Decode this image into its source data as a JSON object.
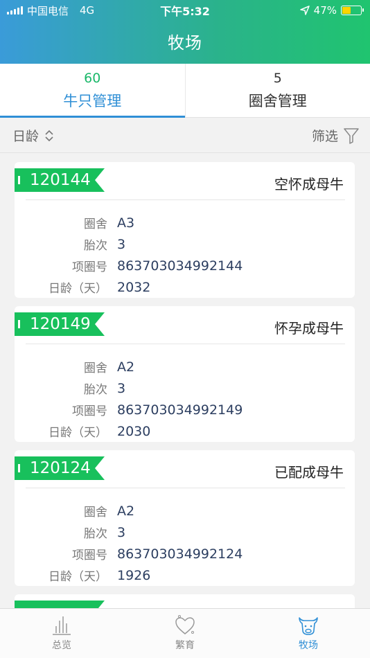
{
  "status_bar": {
    "carrier": "中国电信",
    "network": "4G",
    "time": "下午5:32",
    "battery": "47%",
    "battery_level": 0.47
  },
  "header": {
    "title": "牧场"
  },
  "tabs": [
    {
      "count": "60",
      "label": "牛只管理",
      "active": true
    },
    {
      "count": "5",
      "label": "圈舍管理",
      "active": false
    }
  ],
  "toolbar": {
    "sort_label": "日龄",
    "filter_label": "筛选"
  },
  "cards": [
    {
      "id": "120144",
      "status": "空怀成母牛",
      "pen_label": "圈舍",
      "pen": "A3",
      "parity_label": "胎次",
      "parity": "3",
      "collar_label": "项圈号",
      "collar": "86370303499214​4",
      "age_label": "日龄（天）",
      "age": "2032"
    },
    {
      "id": "120149",
      "status": "怀孕成母牛",
      "pen_label": "圈舍",
      "pen": "A2",
      "parity_label": "胎次",
      "parity": "3",
      "collar_label": "项圈号",
      "collar": "863703034992149",
      "age_label": "日龄（天）",
      "age": "2030"
    },
    {
      "id": "120124",
      "status": "已配成母牛",
      "pen_label": "圈舍",
      "pen": "A2",
      "parity_label": "胎次",
      "parity": "3",
      "collar_label": "项圈号",
      "collar": "863703034992124",
      "age_label": "日龄（天）",
      "age": "1926"
    }
  ],
  "nav": [
    {
      "label": "总览",
      "icon": "chart-bars-icon"
    },
    {
      "label": "繁育",
      "icon": "heart-icon"
    },
    {
      "label": "牧场",
      "icon": "cow-icon"
    }
  ],
  "colors": {
    "accent_green": "#1bb86a",
    "accent_blue": "#2f8fd6",
    "tag_green": "#18c05c"
  }
}
